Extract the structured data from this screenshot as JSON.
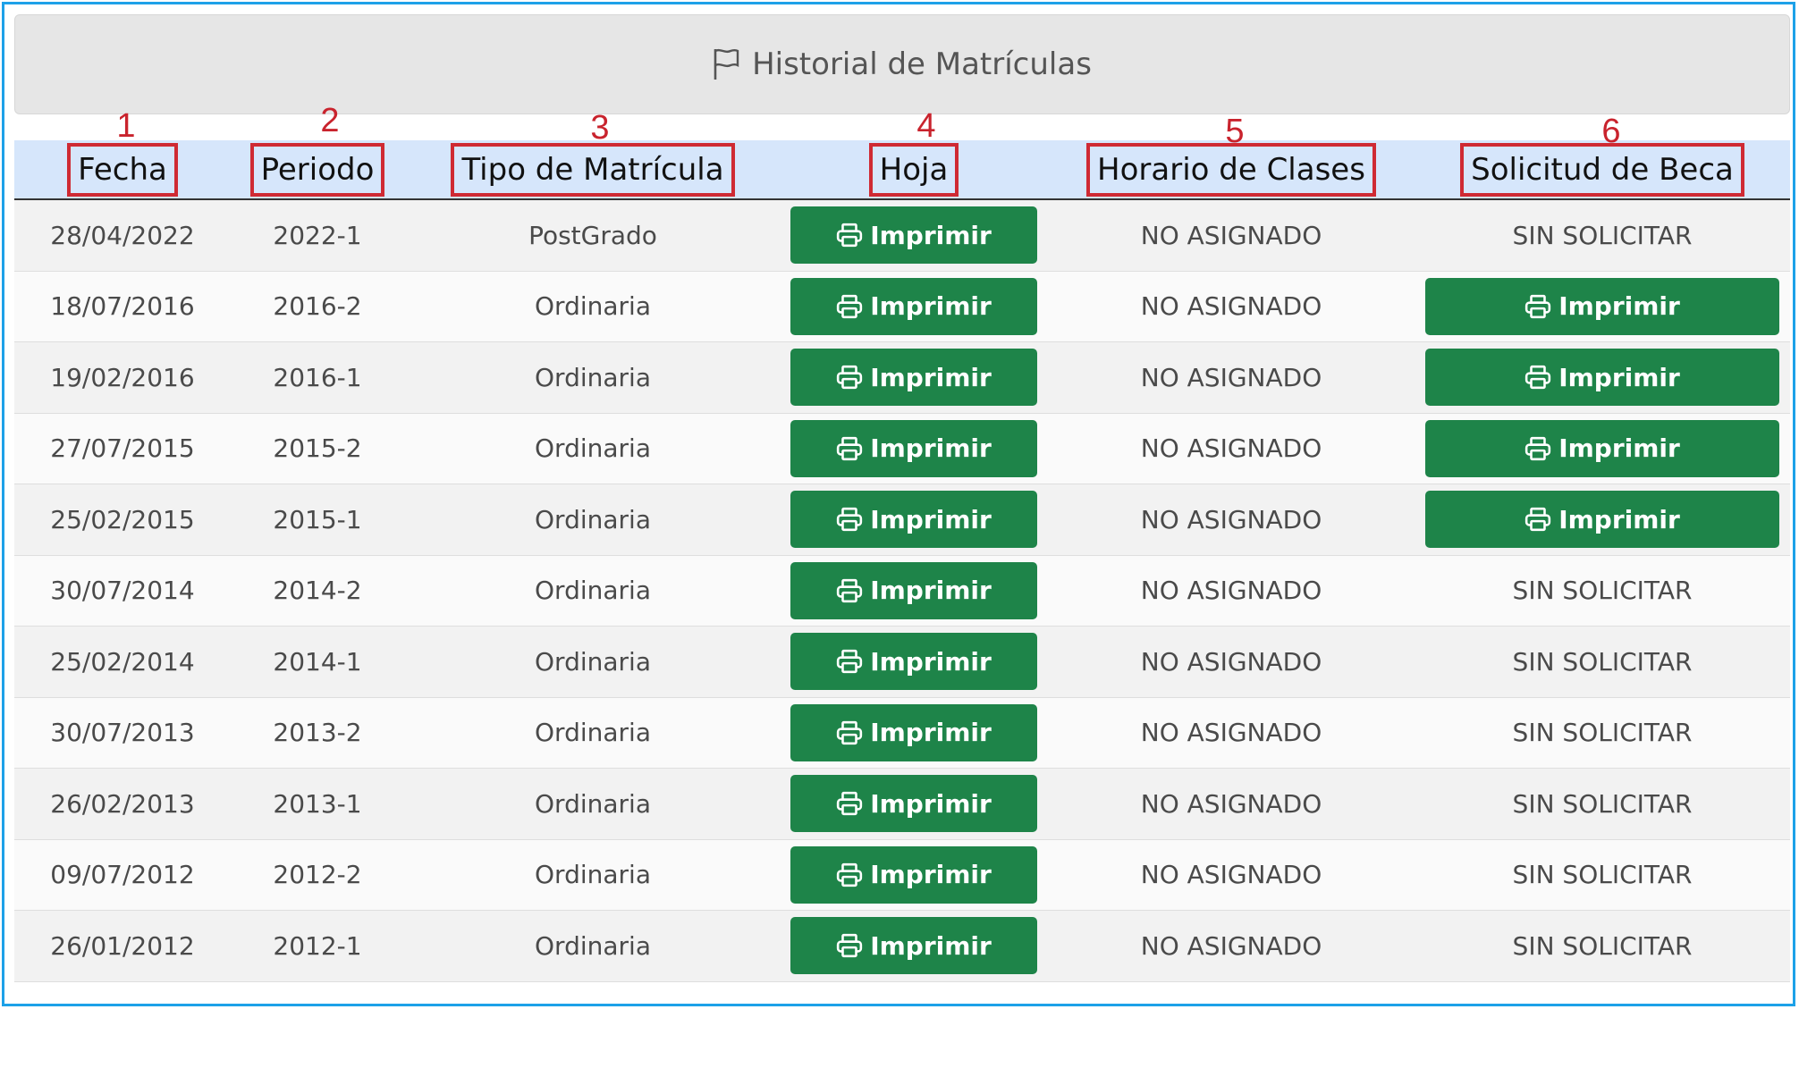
{
  "title": "Historial de Matrículas",
  "columns": [
    {
      "label": "Fecha",
      "number": "1"
    },
    {
      "label": "Periodo",
      "number": "2"
    },
    {
      "label": "Tipo de Matrícula",
      "number": "3"
    },
    {
      "label": "Hoja",
      "number": "4"
    },
    {
      "label": "Horario de Clases",
      "number": "5"
    },
    {
      "label": "Solicitud de Beca",
      "number": "6"
    }
  ],
  "button_label": "Imprimir",
  "colors": {
    "button": "#1e8449",
    "header_bg": "#d6e6fb",
    "highlight": "#cf2a33",
    "frame": "#1da1e8"
  },
  "rows": [
    {
      "fecha": "28/04/2022",
      "periodo": "2022-1",
      "tipo": "PostGrado",
      "horario": "NO ASIGNADO",
      "beca": "SIN SOLICITAR",
      "beca_printable": false
    },
    {
      "fecha": "18/07/2016",
      "periodo": "2016-2",
      "tipo": "Ordinaria",
      "horario": "NO ASIGNADO",
      "beca": "Imprimir",
      "beca_printable": true
    },
    {
      "fecha": "19/02/2016",
      "periodo": "2016-1",
      "tipo": "Ordinaria",
      "horario": "NO ASIGNADO",
      "beca": "Imprimir",
      "beca_printable": true
    },
    {
      "fecha": "27/07/2015",
      "periodo": "2015-2",
      "tipo": "Ordinaria",
      "horario": "NO ASIGNADO",
      "beca": "Imprimir",
      "beca_printable": true
    },
    {
      "fecha": "25/02/2015",
      "periodo": "2015-1",
      "tipo": "Ordinaria",
      "horario": "NO ASIGNADO",
      "beca": "Imprimir",
      "beca_printable": true
    },
    {
      "fecha": "30/07/2014",
      "periodo": "2014-2",
      "tipo": "Ordinaria",
      "horario": "NO ASIGNADO",
      "beca": "SIN SOLICITAR",
      "beca_printable": false
    },
    {
      "fecha": "25/02/2014",
      "periodo": "2014-1",
      "tipo": "Ordinaria",
      "horario": "NO ASIGNADO",
      "beca": "SIN SOLICITAR",
      "beca_printable": false
    },
    {
      "fecha": "30/07/2013",
      "periodo": "2013-2",
      "tipo": "Ordinaria",
      "horario": "NO ASIGNADO",
      "beca": "SIN SOLICITAR",
      "beca_printable": false
    },
    {
      "fecha": "26/02/2013",
      "periodo": "2013-1",
      "tipo": "Ordinaria",
      "horario": "NO ASIGNADO",
      "beca": "SIN SOLICITAR",
      "beca_printable": false
    },
    {
      "fecha": "09/07/2012",
      "periodo": "2012-2",
      "tipo": "Ordinaria",
      "horario": "NO ASIGNADO",
      "beca": "SIN SOLICITAR",
      "beca_printable": false
    },
    {
      "fecha": "26/01/2012",
      "periodo": "2012-1",
      "tipo": "Ordinaria",
      "horario": "NO ASIGNADO",
      "beca": "SIN SOLICITAR",
      "beca_printable": false
    }
  ]
}
